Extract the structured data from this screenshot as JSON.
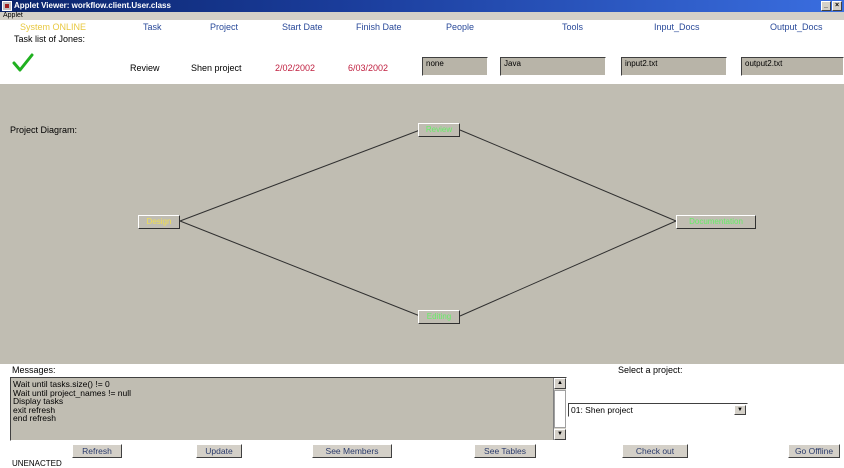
{
  "window": {
    "title": "Applet Viewer: workflow.client.User.class",
    "menu": "Applet"
  },
  "header": {
    "status": "System ONLINE",
    "columns": [
      "Task",
      "Project",
      "Start Date",
      "Finish Date",
      "People",
      "Tools",
      "Input_Docs",
      "Output_Docs"
    ]
  },
  "tasklist": {
    "label": "Task list of Jones:",
    "row": {
      "task": "Review",
      "project": "Shen project",
      "start": "2/02/2002",
      "finish": "6/03/2002",
      "people": "none",
      "tools": "Java",
      "input": "input2.txt",
      "output": "output2.txt"
    }
  },
  "diagram": {
    "label": "Project Diagram:",
    "nodes": [
      "Review",
      "Design",
      "Documentation",
      "Editing"
    ]
  },
  "messages": {
    "label": "Messages:",
    "lines": [
      "Wait until tasks.size() != 0",
      "Wait until project_names != null",
      "Display tasks",
      "exit refresh",
      "end refresh"
    ]
  },
  "project_select": {
    "label": "Select a project:",
    "value": "01: Shen project"
  },
  "buttons": {
    "refresh": "Refresh",
    "update": "Update",
    "members": "See Members",
    "tables": "See Tables",
    "checkout": "Check out",
    "offline": "Go Offline"
  },
  "status": "UNENACTED",
  "colors": {
    "node_text": "#66ee66",
    "date": "#c02040",
    "online": "#e8c840",
    "canvas": "#c0bdb2"
  }
}
